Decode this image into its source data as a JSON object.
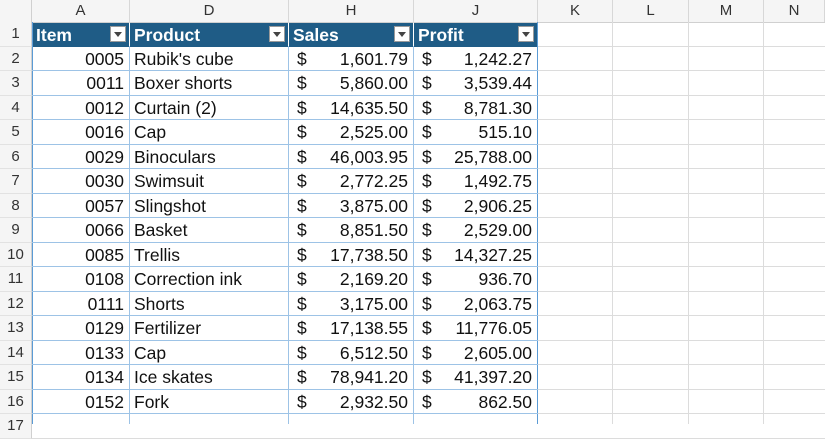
{
  "column_headers": [
    "A",
    "D",
    "H",
    "J",
    "K",
    "L",
    "M",
    "N"
  ],
  "row_headers": [
    "1",
    "2",
    "3",
    "4",
    "5",
    "6",
    "7",
    "8",
    "9",
    "10",
    "11",
    "12",
    "13",
    "14",
    "15",
    "16",
    "17"
  ],
  "table": {
    "headers": [
      "Item",
      "Product",
      "Sales",
      "Profit"
    ],
    "currency_symbol": "$",
    "rows": [
      {
        "item": "0005",
        "product": "Rubik's cube",
        "sales": "1,601.79",
        "profit": "1,242.27"
      },
      {
        "item": "0011",
        "product": "Boxer shorts",
        "sales": "5,860.00",
        "profit": "3,539.44"
      },
      {
        "item": "0012",
        "product": "Curtain (2)",
        "sales": "14,635.50",
        "profit": "8,781.30"
      },
      {
        "item": "0016",
        "product": "Cap",
        "sales": "2,525.00",
        "profit": "515.10"
      },
      {
        "item": "0029",
        "product": "Binoculars",
        "sales": "46,003.95",
        "profit": "25,788.00"
      },
      {
        "item": "0030",
        "product": "Swimsuit",
        "sales": "2,772.25",
        "profit": "1,492.75"
      },
      {
        "item": "0057",
        "product": "Slingshot",
        "sales": "3,875.00",
        "profit": "2,906.25"
      },
      {
        "item": "0066",
        "product": "Basket",
        "sales": "8,851.50",
        "profit": "2,529.00"
      },
      {
        "item": "0085",
        "product": "Trellis",
        "sales": "17,738.50",
        "profit": "14,327.25"
      },
      {
        "item": "0108",
        "product": "Correction ink",
        "sales": "2,169.20",
        "profit": "936.70"
      },
      {
        "item": "0111",
        "product": "Shorts",
        "sales": "3,175.00",
        "profit": "2,063.75"
      },
      {
        "item": "0129",
        "product": "Fertilizer",
        "sales": "17,138.55",
        "profit": "11,776.05"
      },
      {
        "item": "0133",
        "product": "Cap",
        "sales": "6,512.50",
        "profit": "2,605.00"
      },
      {
        "item": "0134",
        "product": "Ice skates",
        "sales": "78,941.20",
        "profit": "41,397.20"
      },
      {
        "item": "0152",
        "product": "Fork",
        "sales": "2,932.50",
        "profit": "862.50"
      }
    ]
  },
  "colors": {
    "table_header_bg": "#1f5c86",
    "table_border": "#5b9bd5"
  }
}
